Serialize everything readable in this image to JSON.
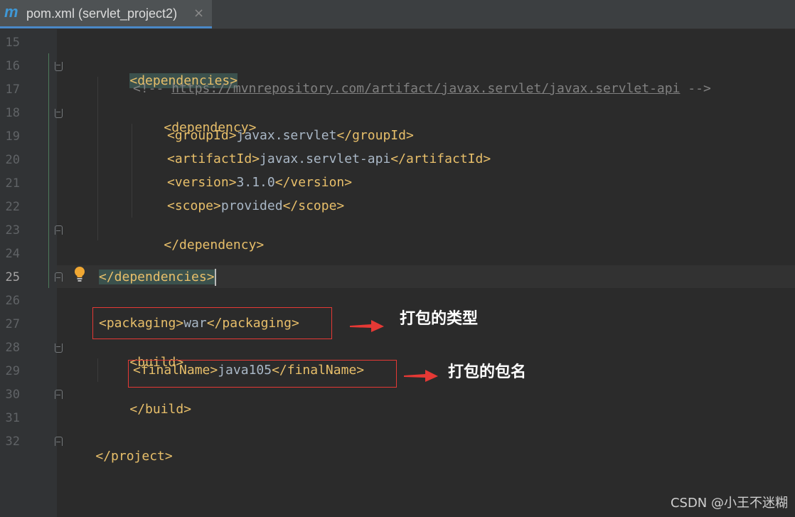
{
  "tab": {
    "icon": "maven-m-icon",
    "icon_text": "m",
    "title": "pom.xml (servlet_project2)",
    "close": "×"
  },
  "editor": {
    "current_line": "25",
    "lines": [
      {
        "no": "15"
      },
      {
        "no": "16",
        "tag": "<dependencies>"
      },
      {
        "no": "17",
        "open": "<!-- ",
        "url": "https://mvnrepository.com/artifact/javax.servlet/javax.servlet-api",
        "close": " -->"
      },
      {
        "no": "18",
        "tag": "<dependency>"
      },
      {
        "no": "19",
        "open": "<groupId>",
        "value": "javax.servlet",
        "close": "</groupId>"
      },
      {
        "no": "20",
        "open": "<artifactId>",
        "value": "javax.servlet-api",
        "close": "</artifactId>"
      },
      {
        "no": "21",
        "open": "<version>",
        "value": "3.1.0",
        "close": "</version>"
      },
      {
        "no": "22",
        "open": "<scope>",
        "value": "provided",
        "close": "</scope>"
      },
      {
        "no": "23",
        "tag": "</dependency>"
      },
      {
        "no": "24"
      },
      {
        "no": "25",
        "tag": "</dependencies>"
      },
      {
        "no": "26"
      },
      {
        "no": "27",
        "open": "<packaging>",
        "value": "war",
        "close": "</packaging>"
      },
      {
        "no": "28",
        "tag": "<build>"
      },
      {
        "no": "29",
        "open": "<finalName>",
        "value": "java105",
        "close": "</finalName>"
      },
      {
        "no": "30",
        "tag": "</build>"
      },
      {
        "no": "31"
      },
      {
        "no": "32",
        "tag": "</project>"
      }
    ]
  },
  "annotations": {
    "packaging_note": "打包的类型",
    "finalname_note": "打包的包名"
  },
  "watermark": "CSDN @小王不迷糊",
  "colors": {
    "background": "#2b2b2b",
    "tag": "#e8bf6a",
    "text": "#a9b7c6",
    "comment": "#808080",
    "annotation_box": "#e53935",
    "accent_tab": "#4a88c7"
  }
}
